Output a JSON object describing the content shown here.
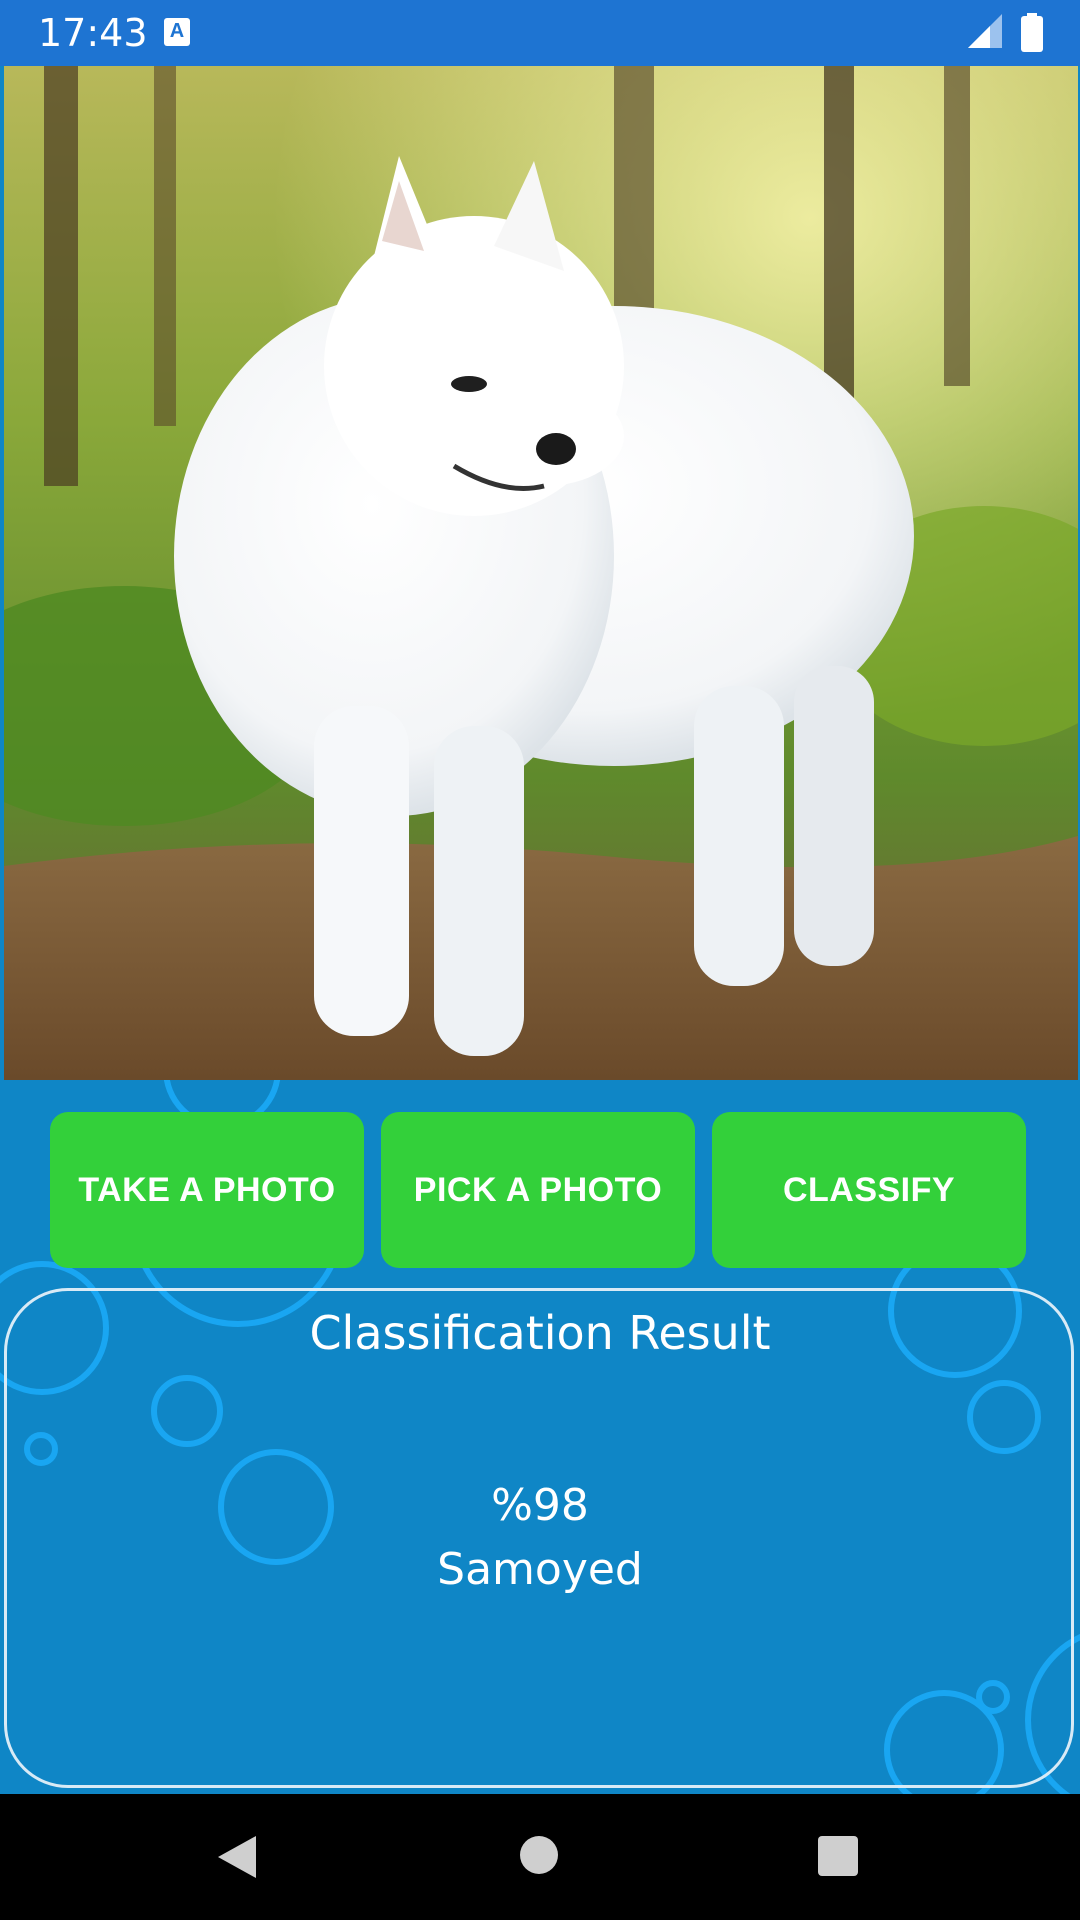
{
  "status_bar": {
    "time": "17:43",
    "notification_icon": "accessibility-a-icon",
    "signal_icon": "cell-signal-icon",
    "battery_icon": "battery-full-icon"
  },
  "photo": {
    "subject": "white fluffy dog in forest"
  },
  "buttons": {
    "take_photo": "TAKE A PHOTO",
    "pick_photo": "PICK A PHOTO",
    "classify": "CLASSIFY"
  },
  "result": {
    "title": "Classification Result",
    "percent": "%98",
    "label": "Samoyed"
  },
  "navigation": {
    "back_icon": "back-triangle-icon",
    "home_icon": "home-circle-icon",
    "recents_icon": "recents-square-icon"
  },
  "colors": {
    "status_bar": "#1e74d2",
    "background": "#0f86c6",
    "button": "#33d03a",
    "bubble": "#19a6f2"
  }
}
